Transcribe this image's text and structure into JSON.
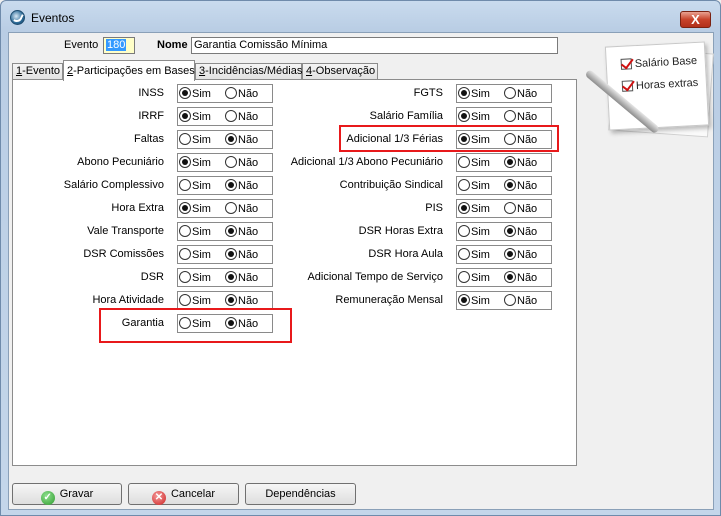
{
  "window": {
    "title": "Eventos",
    "close_glyph": "X"
  },
  "form": {
    "evento_label": "Evento",
    "evento_value": "180",
    "nome_label": "Nome",
    "nome_value": "Garantia Comissão Mínima"
  },
  "tabs": [
    {
      "key": "1",
      "rest": "-Evento",
      "active": false
    },
    {
      "key": "2",
      "rest": "-Participações em Bases",
      "active": true
    },
    {
      "key": "3",
      "rest": "-Incidências/Médias",
      "active": false
    },
    {
      "key": "4",
      "rest": "-Observação",
      "active": false
    }
  ],
  "options": {
    "sim": "Sim",
    "nao": "Não"
  },
  "left_rows": [
    {
      "label": "INSS",
      "value": "Sim"
    },
    {
      "label": "IRRF",
      "value": "Sim"
    },
    {
      "label": "Faltas",
      "value": "Não"
    },
    {
      "label": "Abono Pecuniário",
      "value": "Sim"
    },
    {
      "label": "Salário Complessivo",
      "value": "Não"
    },
    {
      "label": "Hora Extra",
      "value": "Sim"
    },
    {
      "label": "Vale Transporte",
      "value": "Não"
    },
    {
      "label": "DSR Comissões",
      "value": "Não"
    },
    {
      "label": "DSR",
      "value": "Não"
    },
    {
      "label": "Hora Atividade",
      "value": "Não"
    },
    {
      "label": "Garantia",
      "value": "Não"
    }
  ],
  "right_rows": [
    {
      "label": "FGTS",
      "value": "Sim"
    },
    {
      "label": "Salário Família",
      "value": "Sim"
    },
    {
      "label": "Adicional 1/3 Férias",
      "value": "Sim"
    },
    {
      "label": "Adicional 1/3 Abono Pecuniário",
      "value": "Não"
    },
    {
      "label": "Contribuição Sindical",
      "value": "Não"
    },
    {
      "label": "PIS",
      "value": "Sim"
    },
    {
      "label": "DSR Horas Extra",
      "value": "Não"
    },
    {
      "label": "DSR Hora Aula",
      "value": "Não"
    },
    {
      "label": "Adicional Tempo de Serviço",
      "value": "Não"
    },
    {
      "label": "Remuneração Mensal",
      "value": "Sim"
    }
  ],
  "highlighted_rows": [
    "Garantia",
    "Adicional 1/3 Férias"
  ],
  "highlight_color": "#e8191b",
  "decoration": {
    "items": [
      "Salário Base",
      "Horas extras"
    ]
  },
  "buttons": {
    "gravar": "Gravar",
    "cancelar": "Cancelar",
    "dependencias": "Dependências"
  }
}
